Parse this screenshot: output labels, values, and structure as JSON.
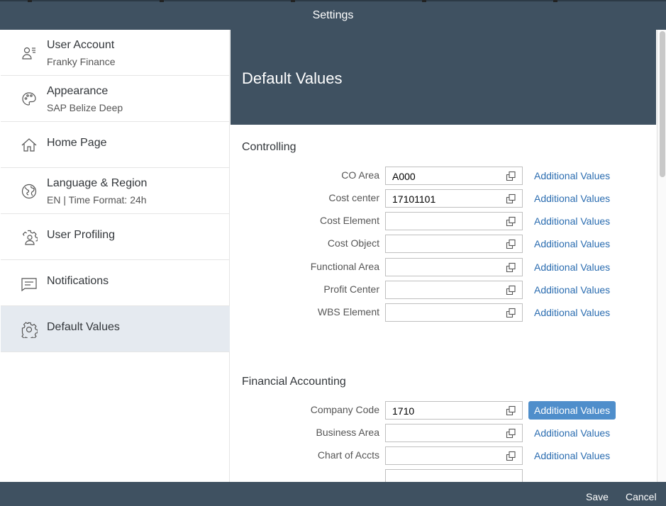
{
  "dialog": {
    "title": "Settings"
  },
  "sidebar": {
    "items": [
      {
        "label": "User Account",
        "sub": "Franky Finance",
        "icon": "user-account-icon"
      },
      {
        "label": "Appearance",
        "sub": "SAP Belize Deep",
        "icon": "palette-icon"
      },
      {
        "label": "Home Page",
        "sub": "",
        "icon": "home-icon"
      },
      {
        "label": "Language & Region",
        "sub": "EN | Time Format: 24h",
        "icon": "globe-icon"
      },
      {
        "label": "User Profiling",
        "sub": "",
        "icon": "user-profiling-icon"
      },
      {
        "label": "Notifications",
        "sub": "",
        "icon": "notifications-icon"
      },
      {
        "label": "Default Values",
        "sub": "",
        "icon": "gear-icon",
        "selected": true
      }
    ]
  },
  "content": {
    "title": "Default Values",
    "sections": [
      {
        "title": "Controlling",
        "rows": [
          {
            "label": "CO Area",
            "value": "A000",
            "link": "Additional Values"
          },
          {
            "label": "Cost center",
            "value": "17101101",
            "link": "Additional Values"
          },
          {
            "label": "Cost Element",
            "value": "",
            "link": "Additional Values"
          },
          {
            "label": "Cost Object",
            "value": "",
            "link": "Additional Values"
          },
          {
            "label": "Functional Area",
            "value": "",
            "link": "Additional Values"
          },
          {
            "label": "Profit Center",
            "value": "",
            "link": "Additional Values"
          },
          {
            "label": "WBS Element",
            "value": "",
            "link": "Additional Values"
          }
        ]
      },
      {
        "title": "Financial Accounting",
        "rows": [
          {
            "label": "Company Code",
            "value": "1710",
            "link": "Additional Values",
            "active": true
          },
          {
            "label": "Business Area",
            "value": "",
            "link": "Additional Values"
          },
          {
            "label": "Chart of Accts",
            "value": "",
            "link": "Additional Values"
          }
        ]
      }
    ]
  },
  "footer": {
    "save": "Save",
    "cancel": "Cancel"
  },
  "colors": {
    "shell": "#3f5161",
    "link": "#2a6cb0",
    "active_link_bg": "#4f8ecb",
    "selected_item_bg": "#e5eaf0"
  }
}
